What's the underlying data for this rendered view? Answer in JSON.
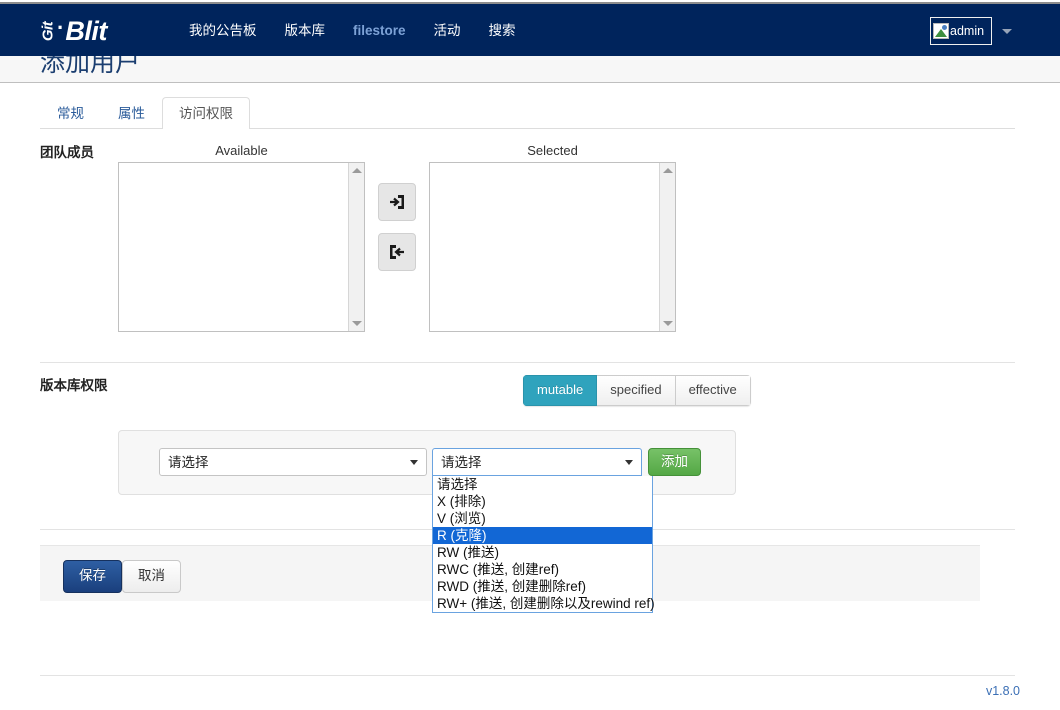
{
  "navbar": {
    "brand": {
      "git": "Git",
      "dot": "·",
      "blit": "Blit"
    },
    "links": [
      {
        "label": "我的公告板",
        "accent": false
      },
      {
        "label": "版本库",
        "accent": false
      },
      {
        "label": "filestore",
        "accent": true
      },
      {
        "label": "活动",
        "accent": false
      },
      {
        "label": "搜索",
        "accent": false
      }
    ],
    "user": {
      "name": "admin",
      "avatar_icon": "broken-image-icon",
      "caret_icon": "chevron-down-icon"
    },
    "background_color": "#00245c",
    "accent_link_color": "#7da2d6"
  },
  "page": {
    "title": "添加用户"
  },
  "tabs": [
    {
      "label": "常规",
      "active": false
    },
    {
      "label": "属性",
      "active": false
    },
    {
      "label": "访问权限",
      "active": true
    }
  ],
  "team_members": {
    "label": "团队成员",
    "available_caption": "Available",
    "selected_caption": "Selected",
    "available_items": [],
    "selected_items": [],
    "transfer_buttons": [
      {
        "icon": "arrow-right-into-box-icon",
        "direction": "add"
      },
      {
        "icon": "arrow-left-out-of-box-icon",
        "direction": "remove"
      }
    ]
  },
  "repository_permissions": {
    "label": "版本库权限",
    "view_modes": [
      {
        "label": "mutable",
        "active": true
      },
      {
        "label": "specified",
        "active": false
      },
      {
        "label": "effective",
        "active": false
      }
    ],
    "active_color": "#2fa3bd",
    "repo_select": {
      "value": "请选择",
      "caret_icon": "caret-down-icon"
    },
    "permission_select": {
      "value": "请选择",
      "caret_icon": "caret-down-icon",
      "open": true,
      "options": [
        {
          "label": "请选择",
          "selected": false
        },
        {
          "label": "X (排除)",
          "selected": false
        },
        {
          "label": "V (浏览)",
          "selected": false
        },
        {
          "label": "R (克隆)",
          "selected": true
        },
        {
          "label": "RW (推送)",
          "selected": false
        },
        {
          "label": "RWC (推送, 创建ref)",
          "selected": false
        },
        {
          "label": "RWD (推送, 创建删除ref)",
          "selected": false
        },
        {
          "label": "RW+ (推送, 创建删除以及rewind ref)",
          "selected": false
        }
      ]
    },
    "add_button": "添加"
  },
  "actions": {
    "save": "保存",
    "cancel": "取消"
  },
  "footer": {
    "version": "v1.8.0"
  }
}
